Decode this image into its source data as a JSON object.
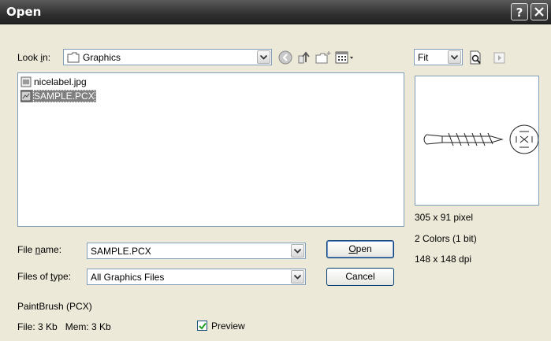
{
  "window": {
    "title": "Open"
  },
  "look_in": {
    "label_prefix": "Look ",
    "label_accel": "i",
    "label_suffix": "n:",
    "value": "Graphics"
  },
  "zoom": {
    "value": "Fit"
  },
  "files": [
    {
      "name": "nicelabel.jpg",
      "selected": false
    },
    {
      "name": "SAMPLE.PCX",
      "selected": true
    }
  ],
  "preview_info": {
    "dimensions": "305 x 91 pixel",
    "colors": "2 Colors (1 bit)",
    "dpi": "148 x 148 dpi"
  },
  "file_name": {
    "label_prefix": "File ",
    "label_accel": "n",
    "label_suffix": "ame:",
    "value": "SAMPLE.PCX"
  },
  "file_type": {
    "label_prefix": "Files of ",
    "label_accel": "t",
    "label_suffix": "ype:",
    "value": "All Graphics Files"
  },
  "buttons": {
    "open_accel": "O",
    "open_rest": "pen",
    "cancel": "Cancel"
  },
  "status": {
    "format": "PaintBrush (PCX)",
    "sizes": "File: 3 Kb   Mem: 3 Kb"
  },
  "preview_checkbox": {
    "label": "Preview",
    "checked": true
  },
  "colors": {
    "dialog_bg": "#ece9d8",
    "titlebar": "#303030",
    "selection": "#808080"
  }
}
